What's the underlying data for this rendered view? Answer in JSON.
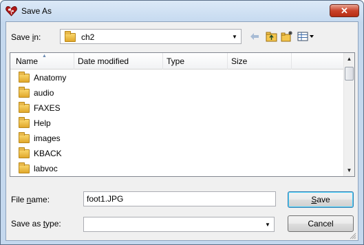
{
  "window": {
    "title": "Save As",
    "close_glyph": "✕"
  },
  "toolbar": {
    "save_in_label_pre": "Save ",
    "save_in_label_accel": "i",
    "save_in_label_post": "n:",
    "save_in_value": "ch2",
    "icons": [
      "back-arrow-icon",
      "up-folder-icon",
      "new-folder-icon",
      "view-menu-icon"
    ]
  },
  "list": {
    "columns": [
      "Name",
      "Date modified",
      "Type",
      "Size"
    ],
    "items": [
      "Anatomy",
      "audio",
      "FAXES",
      "Help",
      "images",
      "KBACK",
      "labvoc"
    ]
  },
  "form": {
    "file_name_pre": "File ",
    "file_name_accel": "n",
    "file_name_post": "ame:",
    "file_name_value": "foot1.JPG",
    "save_type_pre": "Save as ",
    "save_type_accel": "t",
    "save_type_post": "ype:",
    "save_type_value": ""
  },
  "buttons": {
    "save_accel": "S",
    "save_rest": "ave",
    "cancel": "Cancel"
  },
  "colors": {
    "accent": "#3c7fb1",
    "close": "#c9432b"
  }
}
